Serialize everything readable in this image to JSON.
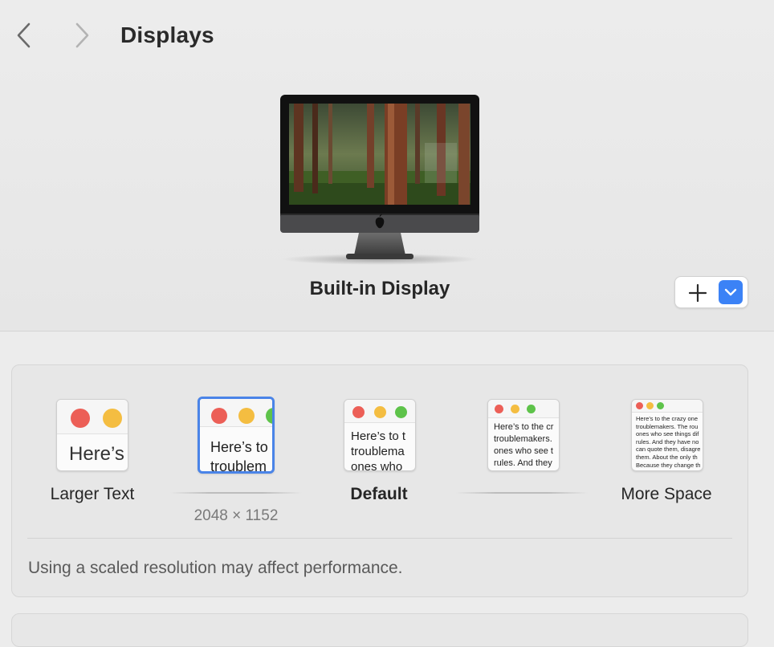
{
  "window": {
    "title": "Displays"
  },
  "icons": {
    "back": "chevron-left-icon",
    "forward": "chevron-right-icon",
    "add": "plus-icon",
    "menu": "chevron-down-icon",
    "monitor": "imac-display-icon"
  },
  "display": {
    "name": "Built-in Display"
  },
  "resolution": {
    "options": [
      {
        "id": "larger-text",
        "label": "Larger Text",
        "preview_text": "Here’s",
        "selected": false
      },
      {
        "id": "option-2",
        "label": "",
        "preview_text": "Here’s to\ntroublem",
        "selected": true
      },
      {
        "id": "default",
        "label": "Default",
        "preview_text": "Here’s to t\ntroublema\nones who",
        "selected": false
      },
      {
        "id": "option-4",
        "label": "",
        "preview_text": "Here’s to the cr\ntroublemakers.\nones who see t\nrules. And they",
        "selected": false
      },
      {
        "id": "more-space",
        "label": "More Space",
        "preview_text": "Here’s to the crazy one\ntroublemakers. The rou\nones who see things dif\nrules. And they have no\ncan quote them, disagre\nthem. About the only th\nBecause they change th",
        "selected": false
      }
    ],
    "current_value": "2048 × 1152",
    "note": "Using a scaled resolution may affect performance."
  },
  "colors": {
    "accent": "#3b82f6",
    "selection": "#4a84e8",
    "dot_red": "#ec5f57",
    "dot_yellow": "#f4bd41",
    "dot_green": "#5ec34a"
  }
}
